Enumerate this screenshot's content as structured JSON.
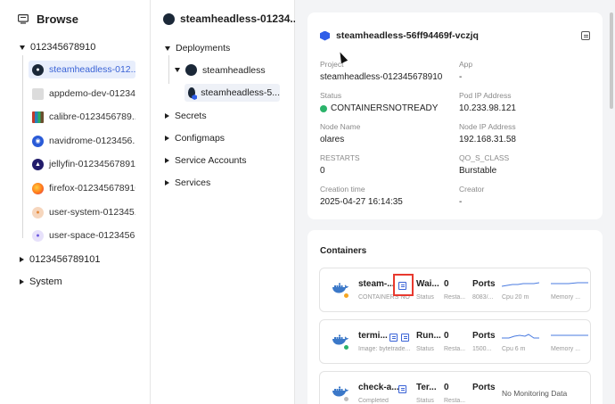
{
  "browse": {
    "title": "Browse",
    "groups": [
      {
        "label": "012345678910",
        "expanded": true,
        "apps": [
          {
            "label": "steamheadless-012...",
            "icon": "steam-icon",
            "color": "#1b2838",
            "selected": true
          },
          {
            "label": "appdemo-dev-01234...",
            "icon": "appdemo-icon",
            "color": "#d9d9d9",
            "selected": false
          },
          {
            "label": "calibre-0123456789...",
            "icon": "calibre-icon",
            "color": "#6b4e2e",
            "selected": false
          },
          {
            "label": "navidrome-0123456...",
            "icon": "navidrome-icon",
            "color": "#2a5bd7",
            "selected": false
          },
          {
            "label": "jellyfin-012345678910",
            "icon": "jellyfin-icon",
            "color": "#221c6b",
            "selected": false
          },
          {
            "label": "firefox-012345678910",
            "icon": "firefox-icon",
            "color": "#ff7a1a",
            "selected": false
          },
          {
            "label": "user-system-012345...",
            "icon": "user-system-icon",
            "color": "#f1a66a",
            "selected": false
          },
          {
            "label": "user-space-0123456...",
            "icon": "user-space-icon",
            "color": "#6f5be0",
            "selected": false
          }
        ]
      },
      {
        "label": "0123456789101",
        "expanded": false
      },
      {
        "label": "System",
        "expanded": false
      }
    ]
  },
  "middle": {
    "title": "steamheadless-01234...",
    "deployments_label": "Deployments",
    "deployment_name": "steamheadless",
    "pod_short": "steamheadless-5...",
    "sections": [
      "Secrets",
      "Configmaps",
      "Service Accounts",
      "Services"
    ]
  },
  "pod": {
    "name": "steamheadless-56ff94469f-vczjq",
    "fields": {
      "project": {
        "label": "Project",
        "value": "steamheadless-012345678910"
      },
      "app": {
        "label": "App",
        "value": "-"
      },
      "status": {
        "label": "Status",
        "value": "CONTAINERSNOTREADY"
      },
      "pod_ip": {
        "label": "Pod IP Address",
        "value": "10.233.98.121"
      },
      "node_name": {
        "label": "Node Name",
        "value": "olares"
      },
      "node_ip": {
        "label": "Node IP Address",
        "value": "192.168.31.58"
      },
      "restarts": {
        "label": "RESTARTS",
        "value": "0"
      },
      "qos": {
        "label": "QO_S_CLASS",
        "value": "Burstable"
      },
      "created": {
        "label": "Creation time",
        "value": "2025-04-27 16:14:35"
      },
      "creator": {
        "label": "Creator",
        "value": "-"
      }
    }
  },
  "containers": {
    "title": "Containers",
    "items": [
      {
        "name": "steam-...",
        "sub": "CONTAINERS NOT",
        "status": "Wai...",
        "status_key": "Status",
        "restarts": "0",
        "restarts_key": "Resta...",
        "ports": "Ports",
        "ports_val": "8083/...",
        "cpu": "Cpu 20 m",
        "memory": "Memory ...",
        "dot_color": "#f5a623"
      },
      {
        "name": "termi...",
        "sub": "Image: bytetrade...",
        "status": "Run...",
        "status_key": "Status",
        "restarts": "0",
        "restarts_key": "Resta...",
        "ports": "Ports",
        "ports_val": "1500...",
        "cpu": "Cpu 6 m",
        "memory": "Memory ...",
        "dot_color": "#2bb36a"
      },
      {
        "name": "check-a...",
        "sub": "Completed",
        "status": "Ter...",
        "status_key": "Status",
        "restarts": "0",
        "restarts_key": "Resta...",
        "ports": "Ports",
        "ports_val": "",
        "no_monitoring": "No Monitoring Data",
        "dot_color": "#bdbdbd"
      }
    ]
  }
}
